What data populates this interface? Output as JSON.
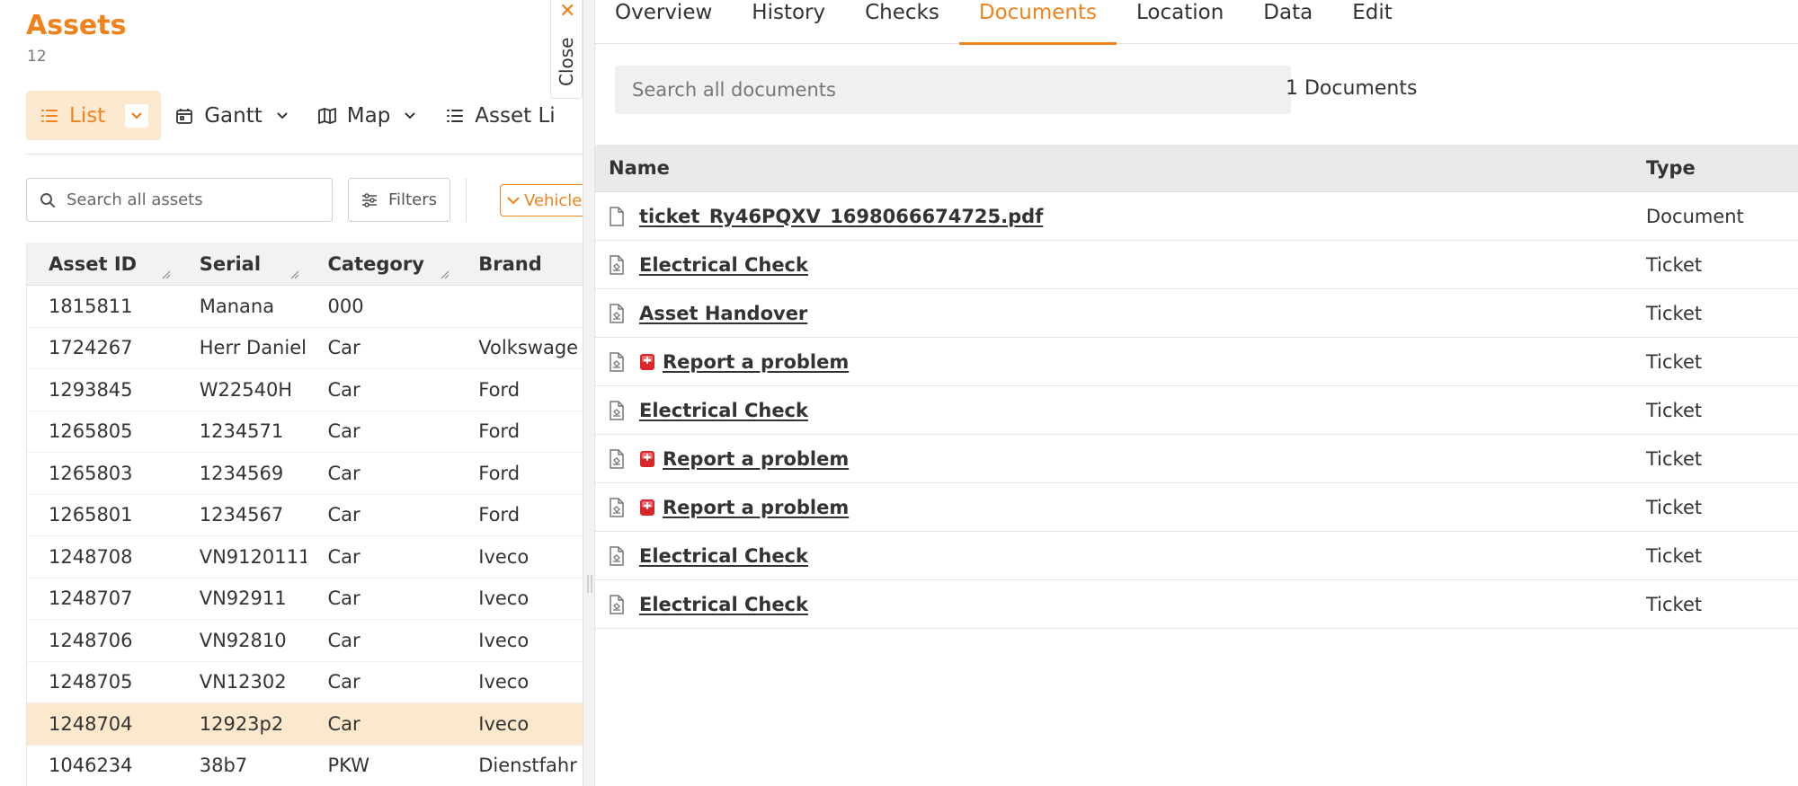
{
  "header": {
    "title": "Assets",
    "count": "12"
  },
  "views": [
    {
      "label": "List",
      "icon": "list-icon",
      "active": true
    },
    {
      "label": "Gantt",
      "icon": "calendar-icon"
    },
    {
      "label": "Map",
      "icon": "map-icon"
    },
    {
      "label": "Asset Li",
      "icon": "list-icon"
    }
  ],
  "toolbar": {
    "search_placeholder": "Search all assets",
    "filters_label": "Filters",
    "vehicle_label": "Vehicle"
  },
  "assets_table": {
    "columns": [
      "Asset ID",
      "Serial",
      "Category",
      "Brand"
    ],
    "rows": [
      [
        "1815811",
        "Manana",
        "000",
        ""
      ],
      [
        "1724267",
        "Herr Daniel",
        "Car",
        "Volkswage"
      ],
      [
        "1293845",
        "W22540H",
        "Car",
        "Ford"
      ],
      [
        "1265805",
        "1234571",
        "Car",
        "Ford"
      ],
      [
        "1265803",
        "1234569",
        "Car",
        "Ford"
      ],
      [
        "1265801",
        "1234567",
        "Car",
        "Ford"
      ],
      [
        "1248708",
        "VN9120111",
        "Car",
        "Iveco"
      ],
      [
        "1248707",
        "VN92911",
        "Car",
        "Iveco"
      ],
      [
        "1248706",
        "VN92810",
        "Car",
        "Iveco"
      ],
      [
        "1248705",
        "VN12302",
        "Car",
        "Iveco"
      ],
      [
        "1248704",
        "12923p2",
        "Car",
        "Iveco"
      ],
      [
        "1046234",
        "38b7",
        "PKW",
        "Dienstfahr"
      ]
    ],
    "selected_row": 10
  },
  "close_tab": {
    "label": "Close"
  },
  "detail": {
    "tabs": [
      "Overview",
      "History",
      "Checks",
      "Documents",
      "Location",
      "Data",
      "Edit"
    ],
    "active_tab": "Documents",
    "search_placeholder": "Search all documents",
    "count_label": "1 Documents",
    "columns": {
      "name": "Name",
      "type": "Type"
    },
    "documents": [
      {
        "name": "ticket_Ry46PQXV_1698066674725.pdf",
        "type": "Document",
        "icon": "file-icon",
        "alert": false
      },
      {
        "name": "Electrical Check",
        "type": "Ticket",
        "icon": "file-ticket-icon",
        "alert": false
      },
      {
        "name": "Asset Handover",
        "type": "Ticket",
        "icon": "file-ticket-icon",
        "alert": false
      },
      {
        "name": "Report a problem",
        "type": "Ticket",
        "icon": "file-ticket-icon",
        "alert": true
      },
      {
        "name": "Electrical Check",
        "type": "Ticket",
        "icon": "file-ticket-icon",
        "alert": false
      },
      {
        "name": "Report a problem",
        "type": "Ticket",
        "icon": "file-ticket-icon",
        "alert": true
      },
      {
        "name": "Report a problem",
        "type": "Ticket",
        "icon": "file-ticket-icon",
        "alert": true
      },
      {
        "name": "Electrical Check",
        "type": "Ticket",
        "icon": "file-ticket-icon",
        "alert": false
      },
      {
        "name": "Electrical Check",
        "type": "Ticket",
        "icon": "file-ticket-icon",
        "alert": false
      }
    ]
  },
  "colors": {
    "accent": "#f0821e",
    "selected_row": "#fce8cc",
    "active_view_bg": "#fde9cf",
    "alert": "#d9262b"
  }
}
